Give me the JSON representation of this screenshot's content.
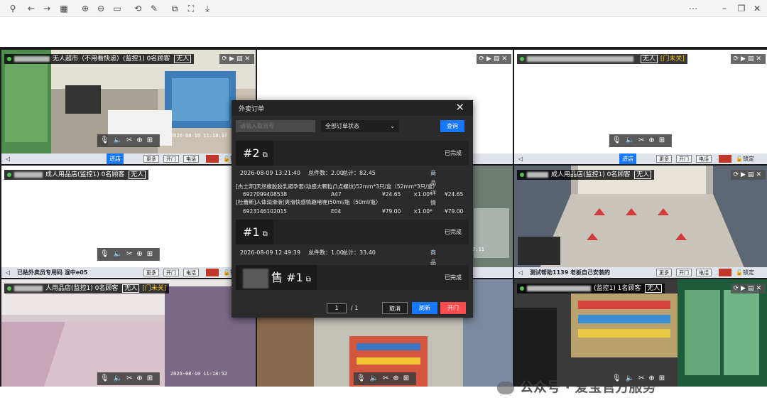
{
  "toolbar_icons": [
    "pin-icon",
    "back-icon",
    "forward-icon",
    "grid-icon",
    "zoom-in-icon",
    "zoom-out-icon",
    "fit-icon",
    "rotate-icon",
    "edit-icon",
    "copy-icon",
    "capture-icon",
    "save-icon",
    "close-dot-icon",
    "minimize-icon",
    "restore-icon",
    "close-icon"
  ],
  "cameras": [
    {
      "title": "无人超市（不用看快递）(监控1)",
      "visitors": "0名顾客",
      "unmanned": "无人",
      "door": "",
      "bar_name": "",
      "enter_btn": "进店",
      "timestamp": "2026-08-10 11:18:37"
    },
    {
      "title": "",
      "visitors": "",
      "unmanned": "",
      "door": "",
      "bar_name": "",
      "enter_btn": "",
      "timestamp": ""
    },
    {
      "title": "",
      "visitors": "",
      "unmanned": "无人",
      "door": "[门未关]",
      "bar_name": "",
      "enter_btn": "进店",
      "timestamp": ""
    },
    {
      "title": "成人用品店(监控1)",
      "visitors": "0名顾客",
      "unmanned": "无人",
      "door": "",
      "bar_name": "已贴外卖员专用码 湿中e05",
      "enter_btn": "",
      "timestamp": ""
    },
    {
      "title": "",
      "visitors": "",
      "unmanned": "",
      "door": "",
      "bar_name": "",
      "enter_btn": "",
      "timestamp": "2026-08-10 11:47:11"
    },
    {
      "title": "成人用品店(监控1)",
      "visitors": "0名顾客",
      "unmanned": "无人",
      "door": "",
      "bar_name": "测试帮助1139 老板自己安装的",
      "enter_btn": "",
      "timestamp": ""
    },
    {
      "title": "人用品店(监控1)",
      "visitors": "0名顾客",
      "unmanned": "无人",
      "door": "[门未关]",
      "bar_name": "",
      "enter_btn": "",
      "timestamp": "2026-08-10 11:18:52"
    },
    {
      "title": "",
      "visitors": "",
      "unmanned": "",
      "door": "",
      "bar_name": "",
      "enter_btn": "",
      "timestamp": ""
    },
    {
      "title": "(监控1)",
      "visitors": "1名顾客",
      "unmanned": "无人",
      "door": "",
      "bar_name": "",
      "enter_btn": "",
      "timestamp": ""
    }
  ],
  "bar_buttons": {
    "more": "更多",
    "open": "开门",
    "phone": "电话",
    "lock": "锁定"
  },
  "modal": {
    "title": "外卖订单",
    "search_placeholder": "请输入取货号",
    "status_filter": "全部订单状态",
    "query": "查询",
    "orders": [
      {
        "number": "#2",
        "status": "已完成",
        "time": "2026-08-09 13:21:40",
        "count": "总件数：2.00",
        "total": "总计：82.45",
        "detail": "商品详情",
        "items": [
          {
            "name": "[杰士邦]天然橡胶胶乳避孕套(动感大颗粒凸点螺纹)52mm*3只/盒（52mm*3只/盒）",
            "barcode": "6927099408538",
            "slot": "A47",
            "price": "¥24.65",
            "qty": "×1.00*",
            "amount": "¥24.65"
          },
          {
            "name": "[杜蕾斯]人体润滑液(爽滑快感情趣啫喱)50ml/瓶（50ml/瓶）",
            "barcode": "6923146102015",
            "slot": "E04",
            "price": "¥79.00",
            "qty": "×1.00*",
            "amount": "¥79.00"
          }
        ]
      },
      {
        "number": "#1",
        "status": "已完成",
        "time": "2026-08-09 12:49:39",
        "count": "总件数：1.00",
        "total": "总计：33.40",
        "detail": "商品详情"
      },
      {
        "number": "售 #1",
        "status": "已完成"
      }
    ],
    "page_current": "1",
    "page_total": "/ 1",
    "cancel": "取消",
    "refresh": "刷新",
    "open_door": "开门"
  },
  "watermark": "公众号 · 爱宝官方服务"
}
